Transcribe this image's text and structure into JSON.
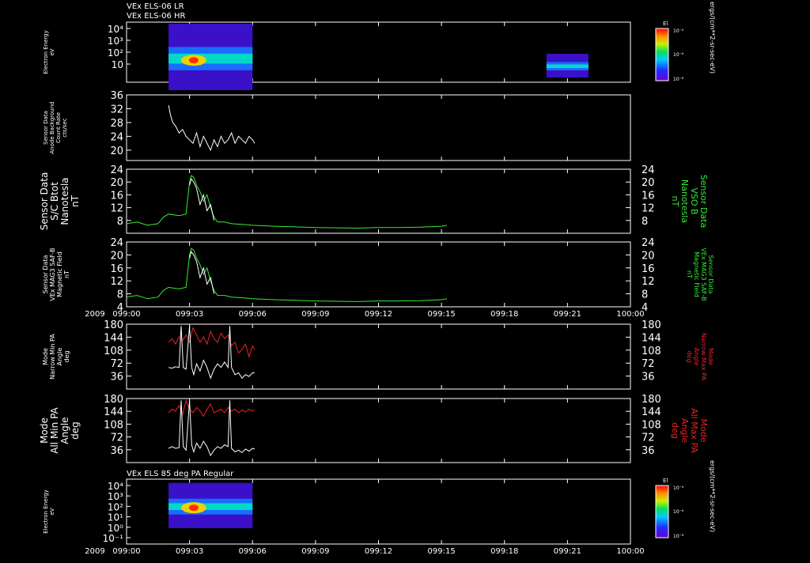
{
  "header": {
    "line1": "VEx ELS-06 LR",
    "line2": "VEx ELS-06 HR",
    "mid_title": "VEx ELS 85 deg PA Regular"
  },
  "colors": {
    "white": "#ffffff",
    "green": "#33ee33",
    "red": "#ee2222",
    "black": "#000000"
  },
  "time_axis": {
    "year": "2009",
    "ticks": [
      "099:00",
      "099:03",
      "099:06",
      "099:09",
      "099:12",
      "099:15",
      "099:18",
      "099:21",
      "100:00"
    ]
  },
  "colorbar": {
    "label": "El",
    "unit": "ergs/(cm**2-sr-sec-eV)",
    "tick_labels": [
      "10⁻⁴",
      "10⁻⁶",
      "10⁻⁸"
    ]
  },
  "chart_data": [
    {
      "type": "heatmap",
      "panel": "spectrogram-top",
      "ylabel": [
        "Electron Energy",
        "eV"
      ],
      "y_tick_labels": [
        "10⁴",
        "10³",
        "10²",
        "10"
      ],
      "xlim": [
        "099:00",
        "100:00"
      ],
      "blocks": [
        {
          "x_start": "099:02",
          "x_end": "099:06",
          "y_range_log10": [
            0,
            4.2
          ]
        },
        {
          "x_start": "099:20",
          "x_end": "099:22",
          "y_range_log10": [
            0.8,
            2.3
          ]
        }
      ]
    },
    {
      "type": "line",
      "panel": "background",
      "ylabel": [
        "Sensor Data",
        "Anode Background",
        "Count Rate",
        "cts/sec"
      ],
      "ylim": [
        17,
        36
      ],
      "y_ticks": [
        20,
        24,
        28,
        32,
        36
      ],
      "series": [
        {
          "color": "#ffffff",
          "x": [
            "099:02:00",
            "099:02:06",
            "099:02:12",
            "099:02:20",
            "099:02:30",
            "099:02:40",
            "099:02:50",
            "099:03:00",
            "099:03:10",
            "099:03:20",
            "099:03:30",
            "099:03:40",
            "099:03:50",
            "099:04:00",
            "099:04:10",
            "099:04:20",
            "099:04:30",
            "099:04:40",
            "099:04:50",
            "099:05:00",
            "099:05:10",
            "099:05:20",
            "099:05:30",
            "099:05:40",
            "099:05:50",
            "099:06:00",
            "099:06:06"
          ],
          "y": [
            33,
            30,
            28,
            27,
            25,
            26,
            24,
            23,
            22,
            25,
            21,
            24,
            22,
            20,
            23,
            21,
            24,
            22,
            23,
            25,
            22,
            24,
            23,
            22,
            24,
            23,
            22
          ]
        }
      ]
    },
    {
      "type": "line",
      "panel": "sc-btot",
      "ylabel": [
        "Sensor Data",
        "S/C Btot",
        "Nanotesla",
        "nT"
      ],
      "ylabel_right": [
        "Sensor Data",
        "VSO B",
        "Nanotesla",
        "nT"
      ],
      "ylim": [
        4,
        24
      ],
      "y_ticks": [
        8,
        12,
        16,
        20,
        24
      ],
      "series": [
        {
          "color": "#33ee33",
          "x": [
            "099:00:00",
            "099:00:30",
            "099:01:00",
            "099:01:30",
            "099:01:45",
            "099:02:00",
            "099:02:30",
            "099:02:50",
            "099:03:00",
            "099:03:05",
            "099:03:12",
            "099:03:20",
            "099:03:30",
            "099:03:40",
            "099:03:50",
            "099:04:00",
            "099:04:10",
            "099:04:20",
            "099:04:40",
            "099:05:00",
            "099:05:30",
            "099:06:00",
            "099:07:00",
            "099:08:00",
            "099:09:00",
            "099:10:00",
            "099:11:00",
            "099:12:00",
            "099:13:00",
            "099:14:00",
            "099:15:00",
            "099:15:15"
          ],
          "y": [
            7,
            7.5,
            6.5,
            7,
            9,
            10,
            9.5,
            10,
            20,
            22,
            21.5,
            19,
            17,
            14,
            16,
            12,
            9,
            7.5,
            7.5,
            7,
            6.8,
            6.5,
            6.2,
            6,
            5.8,
            5.7,
            5.6,
            5.8,
            5.8,
            5.9,
            6.2,
            6.5
          ]
        },
        {
          "color": "#ffffff",
          "x": [
            "099:03:00",
            "099:03:05",
            "099:03:12",
            "099:03:20",
            "099:03:30",
            "099:03:40",
            "099:03:50",
            "099:04:00",
            "099:04:10"
          ],
          "y": [
            19,
            21,
            20,
            18,
            13,
            16,
            11,
            13,
            8
          ]
        }
      ]
    },
    {
      "type": "line",
      "panel": "mag-field",
      "ylabel": [
        "Sensor Data",
        "VEx MAG3 SAF-B",
        "Magnetic Field",
        "nT"
      ],
      "ylabel_right": [
        "Sensor Data",
        "VEx MAG3 SAF-B",
        "Magnetic Field",
        "nT"
      ],
      "ylim": [
        4,
        24
      ],
      "y_ticks": [
        4,
        8,
        12,
        16,
        20,
        24
      ],
      "series": [
        {
          "color": "#33ee33",
          "x": [
            "099:00:00",
            "099:00:30",
            "099:01:00",
            "099:01:30",
            "099:01:45",
            "099:02:00",
            "099:02:30",
            "099:02:50",
            "099:03:00",
            "099:03:05",
            "099:03:12",
            "099:03:20",
            "099:03:30",
            "099:03:40",
            "099:03:50",
            "099:04:00",
            "099:04:10",
            "099:04:20",
            "099:04:40",
            "099:05:00",
            "099:05:30",
            "099:06:00",
            "099:07:00",
            "099:08:00",
            "099:09:00",
            "099:10:00",
            "099:11:00",
            "099:12:00",
            "099:13:00",
            "099:14:00",
            "099:15:00",
            "099:15:15"
          ],
          "y": [
            7,
            7.5,
            6.5,
            7,
            9,
            10,
            9.5,
            10,
            20,
            22,
            21.5,
            19,
            17,
            14,
            16,
            12,
            9,
            7.5,
            7.5,
            7,
            6.8,
            6.5,
            6.2,
            6,
            5.8,
            5.7,
            5.6,
            5.8,
            5.8,
            5.9,
            6.2,
            6.5
          ]
        },
        {
          "color": "#ffffff",
          "x": [
            "099:03:00",
            "099:03:05",
            "099:03:12",
            "099:03:20",
            "099:03:30",
            "099:03:40",
            "099:03:50",
            "099:04:00",
            "099:04:10"
          ],
          "y": [
            19,
            21,
            20,
            18,
            13,
            16,
            11,
            13,
            8
          ]
        }
      ]
    },
    {
      "type": "line",
      "panel": "narrow-pa",
      "ylabel": [
        "Mode",
        "Narrow Min PA",
        "Angle",
        "deg"
      ],
      "ylabel_right": [
        "Mode",
        "Narrow Max PA",
        "Angle",
        "deg"
      ],
      "ylim": [
        0,
        180
      ],
      "y_ticks": [
        36,
        72,
        108,
        144,
        180
      ],
      "series": [
        {
          "color": "#ee2222",
          "x": [
            "099:02:00",
            "099:02:10",
            "099:02:20",
            "099:02:30",
            "099:02:40",
            "099:02:50",
            "099:03:00",
            "099:03:10",
            "099:03:20",
            "099:03:30",
            "099:03:40",
            "099:03:50",
            "099:04:00",
            "099:04:10",
            "099:04:20",
            "099:04:30",
            "099:04:40",
            "099:04:50",
            "099:05:00",
            "099:05:10",
            "099:05:20",
            "099:05:30",
            "099:05:40",
            "099:05:50",
            "099:06:00",
            "099:06:06"
          ],
          "y": [
            130,
            140,
            125,
            145,
            135,
            150,
            130,
            170,
            150,
            130,
            145,
            125,
            160,
            140,
            130,
            155,
            140,
            150,
            120,
            130,
            100,
            110,
            125,
            90,
            120,
            110
          ]
        },
        {
          "color": "#ffffff",
          "x": [
            "099:02:00",
            "099:02:10",
            "099:02:20",
            "099:02:30",
            "099:02:36",
            "099:02:42",
            "099:02:50",
            "099:03:00",
            "099:03:06",
            "099:03:12",
            "099:03:20",
            "099:03:30",
            "099:03:40",
            "099:03:50",
            "099:04:00",
            "099:04:10",
            "099:04:20",
            "099:04:30",
            "099:04:40",
            "099:04:50",
            "099:04:55",
            "099:05:00",
            "099:05:10",
            "099:05:20",
            "099:05:30",
            "099:05:40",
            "099:05:50",
            "099:06:00",
            "099:06:06"
          ],
          "y": [
            60,
            58,
            62,
            60,
            175,
            60,
            55,
            175,
            60,
            40,
            70,
            50,
            80,
            60,
            30,
            55,
            70,
            60,
            75,
            60,
            175,
            60,
            40,
            45,
            30,
            40,
            35,
            45,
            45
          ]
        }
      ]
    },
    {
      "type": "line",
      "panel": "all-pa",
      "ylabel": [
        "Mode",
        "All Min PA",
        "Angle",
        "deg"
      ],
      "ylabel_right": [
        "Mode",
        "All Max PA",
        "Angle",
        "deg"
      ],
      "ylim": [
        0,
        180
      ],
      "y_ticks": [
        36,
        72,
        108,
        144,
        180
      ],
      "series": [
        {
          "color": "#ee2222",
          "x": [
            "099:02:00",
            "099:02:10",
            "099:02:20",
            "099:02:30",
            "099:02:40",
            "099:02:50",
            "099:03:00",
            "099:03:10",
            "099:03:20",
            "099:03:30",
            "099:03:40",
            "099:03:50",
            "099:04:00",
            "099:04:10",
            "099:04:20",
            "099:04:30",
            "099:04:40",
            "099:04:50",
            "099:05:00",
            "099:05:10",
            "099:05:20",
            "099:05:30",
            "099:05:40",
            "099:05:50",
            "099:06:00",
            "099:06:06"
          ],
          "y": [
            140,
            150,
            145,
            160,
            135,
            175,
            150,
            140,
            155,
            145,
            130,
            150,
            165,
            140,
            145,
            150,
            140,
            155,
            145,
            150,
            140,
            148,
            142,
            150,
            145,
            148
          ]
        },
        {
          "color": "#ffffff",
          "x": [
            "099:02:00",
            "099:02:10",
            "099:02:20",
            "099:02:30",
            "099:02:36",
            "099:02:42",
            "099:02:50",
            "099:03:00",
            "099:03:06",
            "099:03:12",
            "099:03:20",
            "099:03:30",
            "099:03:40",
            "099:03:50",
            "099:04:00",
            "099:04:10",
            "099:04:20",
            "099:04:30",
            "099:04:40",
            "099:04:50",
            "099:04:55",
            "099:05:00",
            "099:05:10",
            "099:05:20",
            "099:05:30",
            "099:05:40",
            "099:05:50",
            "099:06:00",
            "099:06:06"
          ],
          "y": [
            40,
            45,
            40,
            42,
            175,
            45,
            35,
            175,
            50,
            30,
            55,
            40,
            60,
            45,
            20,
            35,
            45,
            40,
            50,
            45,
            175,
            40,
            30,
            35,
            28,
            38,
            32,
            40,
            38
          ]
        }
      ]
    },
    {
      "type": "heatmap",
      "panel": "spectrogram-bottom",
      "ylabel": [
        "Electron Energy",
        "eV"
      ],
      "y_tick_labels": [
        "10⁴",
        "10³",
        "10²",
        "10¹",
        "10⁰",
        "10⁻¹"
      ],
      "xlim": [
        "099:00",
        "100:00"
      ],
      "blocks": [
        {
          "x_start": "099:02",
          "x_end": "099:06",
          "y_range_log10": [
            0.3,
            4
          ]
        }
      ]
    }
  ]
}
